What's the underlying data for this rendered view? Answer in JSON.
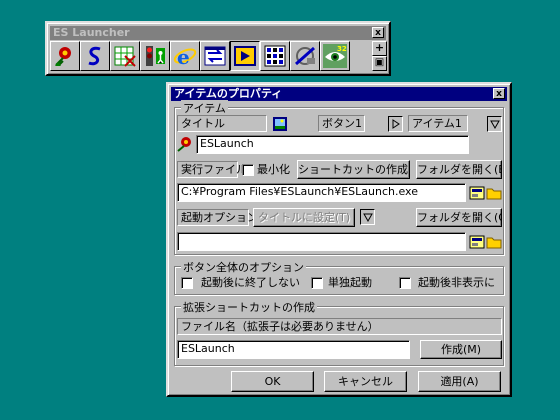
{
  "launcher": {
    "title": "ES Launcher",
    "close_glyph": "x",
    "icons": [
      "red-flower-icon",
      "s-logo-icon",
      "spreadsheet-icon",
      "traffic-light-icon",
      "internet-explorer-icon",
      "swap-arrows-icon",
      "media-player-icon",
      "grid-app-icon",
      "network-icon",
      "eye-icon"
    ],
    "plus_glyph": "+",
    "save_glyph": "▣"
  },
  "dialog": {
    "title": "アイテムのプロパティ",
    "close_glyph": "x",
    "item_group": {
      "title": "アイテム",
      "title_field": "タイトル",
      "button_field": "ボタン1",
      "item_field": "アイテム1",
      "name_value": "ESLaunch",
      "exec_label": "実行ファイル",
      "minimize_label": "最小化",
      "shortcut_button": "ショートカットの作成(X)",
      "open_folder_button": "フォルダを開く(E)",
      "path_value": "C:¥Program Files¥ESLaunch¥ESLaunch.exe",
      "launch_option_label": "起動オプション",
      "set_title_button": "タイトルに設定(T)",
      "open_folder_button2": "フォルダを開く(O)",
      "option_value": ""
    },
    "button_group": {
      "title": "ボタン全体のオプション",
      "exit_after": "起動後に終了しない",
      "single": "単独起動",
      "hide_after": "起動後非表示に"
    },
    "ext_group": {
      "title": "拡張ショートカットの作成",
      "filename_label": "ファイル名（拡張子は必要ありません）",
      "filename_value": "ESLaunch",
      "create_button": "作成(M)"
    },
    "ok_button": "OK",
    "cancel_button": "キャンセル",
    "apply_button": "適用(A)"
  }
}
